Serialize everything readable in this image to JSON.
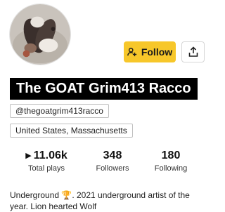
{
  "profile": {
    "name": "The GOAT Grim413 Racco",
    "handle": "@thegoatgrim413racco",
    "location": "United States, Massachusetts",
    "bio_before_icon": "Underground ",
    "bio_icon": "trophy-icon",
    "bio_icon_glyph": "🏆",
    "bio_after_icon": ". 2021 underground artist of the year. Lion hearted Wolf"
  },
  "actions": {
    "follow_label": "Follow",
    "follow_icon": "add-user-icon",
    "share_icon": "share-icon"
  },
  "stats": {
    "total_plays": {
      "icon": "play-icon",
      "value": "11.06k",
      "label": "Total plays"
    },
    "followers": {
      "value": "348",
      "label": "Followers"
    },
    "following": {
      "value": "180",
      "label": "Following"
    }
  },
  "colors": {
    "follow_button": "#f7c72a",
    "name_banner_bg": "#000000",
    "name_banner_text": "#ffffff"
  }
}
